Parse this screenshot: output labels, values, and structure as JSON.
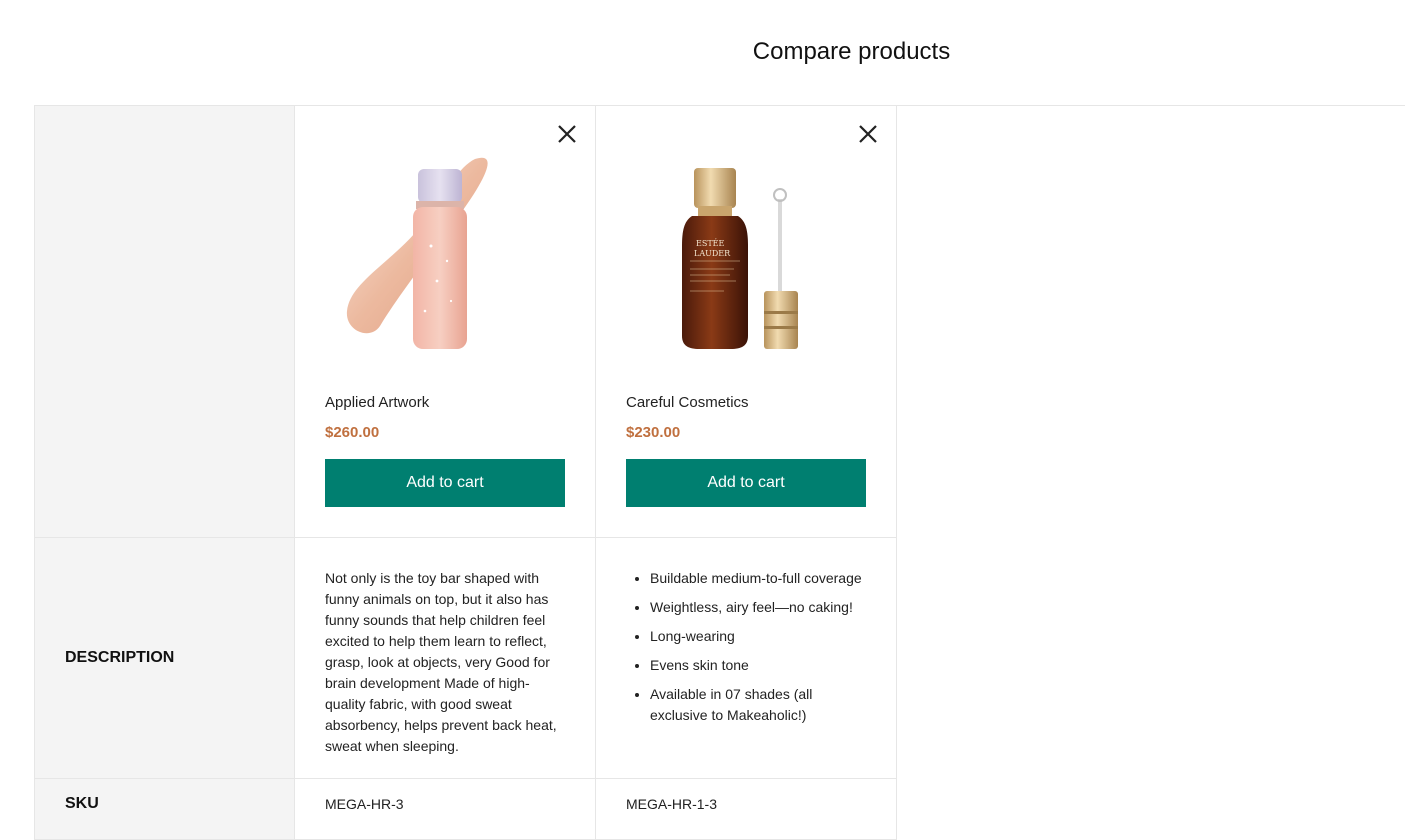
{
  "page": {
    "title": "Compare products"
  },
  "colors": {
    "accent": "#007f70",
    "price": "#c0703f",
    "label_bg": "#f4f4f4",
    "border": "#e6e6e6"
  },
  "products": [
    {
      "name": "Applied Artwork",
      "price": "$260.00",
      "add_to_cart_label": "Add to cart",
      "remove_icon": "close-icon",
      "image": "pink-gloss-bottle",
      "description": "Not only is the toy bar shaped with funny animals on top, but it also has funny sounds that help children feel excited to help them learn to reflect, grasp, look at objects, very Good for brain development Made of high-quality fabric, with good sweat absorbency, helps prevent back heat, sweat when sleeping.",
      "sku": "MEGA-HR-3"
    },
    {
      "name": "Careful Cosmetics",
      "price": "$230.00",
      "add_to_cart_label": "Add to cart",
      "remove_icon": "close-icon",
      "image": "serum-bottle-with-dropper",
      "description_list": [
        "Buildable medium-to-full coverage",
        "Weightless, airy feel—no caking!",
        "Long-wearing",
        "Evens skin tone",
        "Available in 07 shades (all exclusive to Makeaholic!)"
      ],
      "sku": "MEGA-HR-1-3"
    }
  ],
  "rows": {
    "description_label": "DESCRIPTION",
    "sku_label": "SKU"
  },
  "bottle_brand_text": [
    "ESTÉE",
    "LAUDER"
  ]
}
